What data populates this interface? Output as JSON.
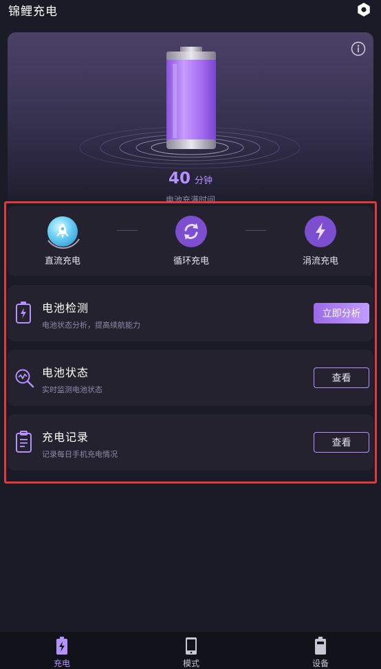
{
  "app": {
    "title": "锦鲤充电"
  },
  "hero": {
    "time_value": "40",
    "time_unit": "分钟",
    "caption": "电池充满时间"
  },
  "modes": [
    {
      "label": "直流充电",
      "icon": "rocket-icon",
      "active": true
    },
    {
      "label": "循环充电",
      "icon": "cycle-icon",
      "active": false
    },
    {
      "label": "涓流充电",
      "icon": "lightning-icon",
      "active": false
    }
  ],
  "cards": [
    {
      "title": "电池检测",
      "subtitle": "电池状态分析，提高续航能力",
      "button": "立即分析",
      "icon": "battery-check-icon"
    },
    {
      "title": "电池状态",
      "subtitle": "实时监测电池状态",
      "button": "查看",
      "icon": "battery-status-icon"
    },
    {
      "title": "充电记录",
      "subtitle": "记录每日手机充电情况",
      "button": "查看",
      "icon": "clipboard-icon"
    }
  ],
  "nav": [
    {
      "label": "充电",
      "icon": "battery-charging-icon",
      "active": true
    },
    {
      "label": "模式",
      "icon": "phone-icon",
      "active": false
    },
    {
      "label": "设备",
      "icon": "battery-icon",
      "active": false
    }
  ],
  "colors": {
    "accent": "#b593ff",
    "background": "#1b1b27",
    "card": "#25222f",
    "highlight": "#e23a3a"
  }
}
